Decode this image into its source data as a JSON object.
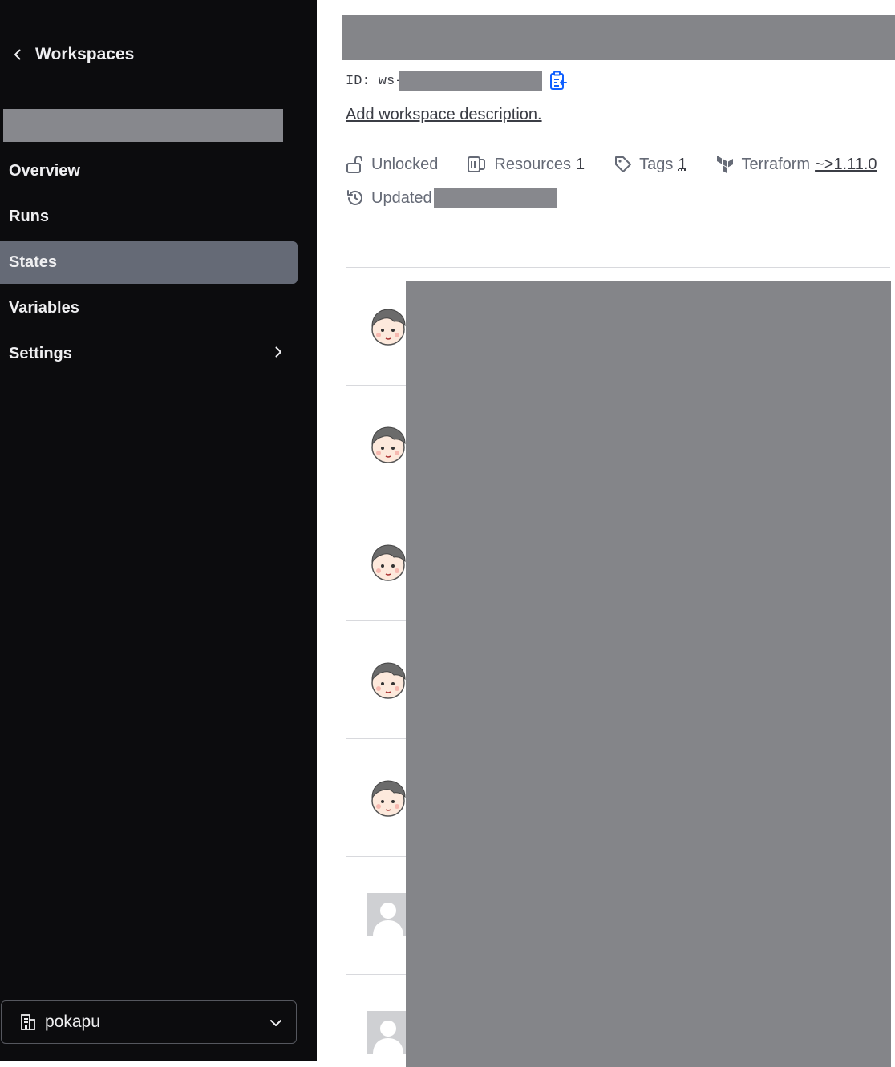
{
  "sidebar": {
    "back_label": "Workspaces",
    "nav": [
      {
        "label": "Overview",
        "active": false
      },
      {
        "label": "Runs",
        "active": false
      },
      {
        "label": "States",
        "active": true
      },
      {
        "label": "Variables",
        "active": false
      },
      {
        "label": "Settings",
        "active": false,
        "has_submenu": true
      }
    ],
    "org_name": "pokapu"
  },
  "workspace": {
    "id_prefix": "ID: ws-",
    "add_description": "Add workspace description.",
    "lock_status": "Unlocked",
    "resources_label": "Resources",
    "resources_count": "1",
    "tags_label": "Tags",
    "tags_count": "1",
    "terraform_label": "Terraform",
    "terraform_version": "~>1.11.0",
    "updated_label": "Updated"
  },
  "states": {
    "avatars": [
      "illustrated-face",
      "illustrated-face",
      "illustrated-face",
      "illustrated-face",
      "illustrated-face",
      "default-user",
      "default-user"
    ]
  },
  "colors": {
    "sidebar_bg": "#0c0c0e",
    "active_nav": "#656a76",
    "copy_icon": "#1060ff",
    "redaction": "#87888d"
  }
}
